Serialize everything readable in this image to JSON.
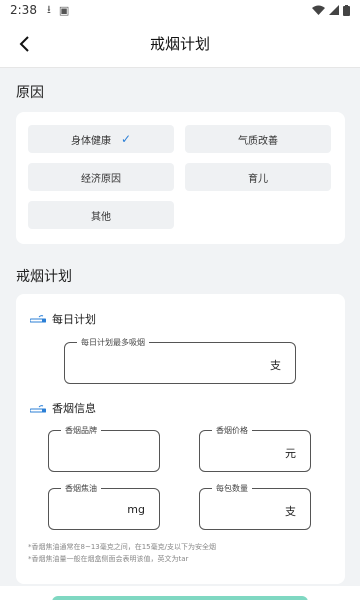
{
  "status": {
    "time": "2:38"
  },
  "header": {
    "title": "戒烟计划"
  },
  "reasons": {
    "section_title": "原因",
    "options": [
      {
        "label": "身体健康",
        "selected": true
      },
      {
        "label": "气质改善",
        "selected": false
      },
      {
        "label": "经济原因",
        "selected": false
      },
      {
        "label": "育儿",
        "selected": false
      },
      {
        "label": "其他",
        "selected": false
      }
    ]
  },
  "plan": {
    "section_title": "戒烟计划",
    "daily": {
      "title": "每日计划",
      "field_label": "每日计划最多吸烟",
      "field_unit": "支"
    },
    "info": {
      "title": "香烟信息",
      "brand_label": "香烟品牌",
      "price_label": "香烟价格",
      "price_unit": "元",
      "tar_label": "香烟焦油",
      "tar_unit": "mg",
      "pack_label": "每包数量",
      "pack_unit": "支"
    },
    "notes": [
      "*香烟焦油通常在8~13毫克之间，在15毫克/支以下为安全烟",
      "*香烟焦油量一般在烟盒侧面会表明该值，英文为tar"
    ]
  },
  "colors": {
    "accent": "#2b7fd6",
    "button": "#7fd8c2",
    "background": "#f1f3f5"
  }
}
